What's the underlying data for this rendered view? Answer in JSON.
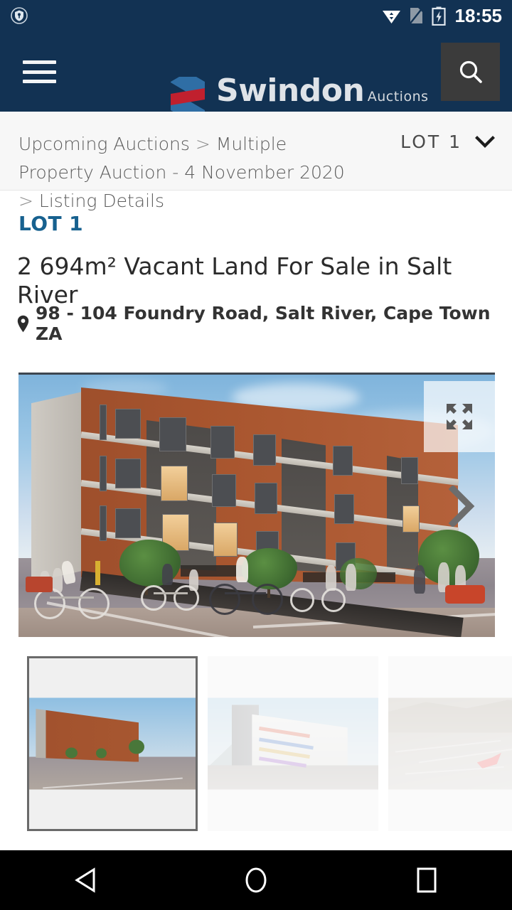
{
  "status_bar": {
    "time": "18:55",
    "icons": [
      "vpn-shield-icon",
      "wifi-icon",
      "sim-card-icon",
      "battery-charging-icon"
    ]
  },
  "header": {
    "menu_icon": "hamburger-menu-icon",
    "logo_title": "Swindon",
    "logo_subtitle": "Auctions",
    "logo_mark_colors": {
      "blue": "#2f6ea5",
      "red": "#c0202e"
    },
    "search_icon": "search-icon",
    "background": "#123253",
    "search_button_background": "#3b3b3b"
  },
  "breadcrumb": {
    "items": [
      "Upcoming Auctions",
      "Multiple Property Auction - 4 November 2020",
      "Listing Details"
    ],
    "separator": ">",
    "full_text_line1": "Upcoming Auctions > Multiple Property",
    "full_text_line2": "Auction - 4 November 2020 > Listing Details"
  },
  "lot_selector": {
    "label": "LOT 1",
    "chevron_icon": "chevron-down-icon"
  },
  "listing": {
    "lot_badge": "LOT 1",
    "lot_badge_color": "#17618f",
    "title": "2 694m² Vacant Land For Sale in Salt River",
    "address": "98 - 104 Foundry Road, Salt River, Cape Town ZA",
    "address_icon": "map-pin-icon"
  },
  "gallery": {
    "expand_icon": "expand-fullscreen-icon",
    "next_icon": "chevron-right-icon",
    "selected_index": 0,
    "thumbnails": [
      {
        "name": "thumbnail-brick-apartment-render",
        "selected": true
      },
      {
        "name": "thumbnail-white-apartment-render",
        "selected": false
      },
      {
        "name": "thumbnail-aerial-site-map",
        "selected": false
      }
    ]
  },
  "nav_bar": {
    "back_icon": "back-triangle-icon",
    "home_icon": "home-circle-icon",
    "recents_icon": "recents-square-icon"
  }
}
